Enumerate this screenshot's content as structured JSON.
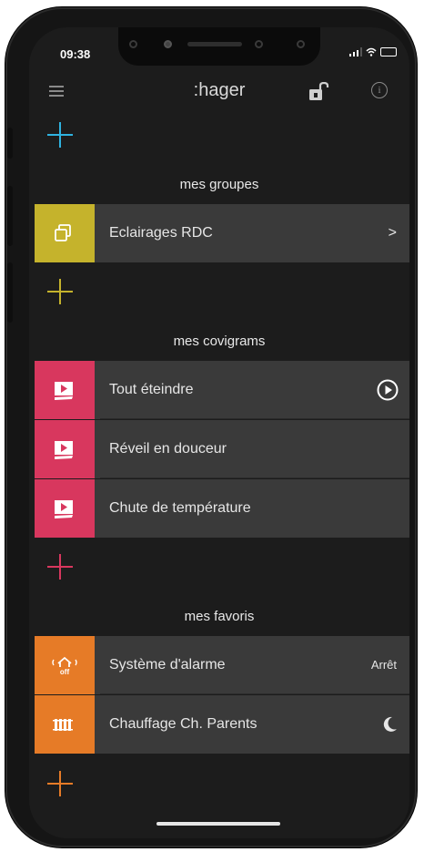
{
  "status": {
    "time": "09:38"
  },
  "app": {
    "logo": ":hager",
    "info_icon": "i"
  },
  "colors": {
    "accent_blue": "#2fb3e0",
    "group_tile": "#c5b32c",
    "covigram_tile": "#d8375e",
    "favori_tile": "#e67b27"
  },
  "sections": {
    "groupes": {
      "title": "mes groupes"
    },
    "covigrams": {
      "title": "mes covigrams"
    },
    "favoris": {
      "title": "mes favoris"
    }
  },
  "groupes": [
    {
      "label": "Eclairages RDC",
      "icon": "group-icon",
      "trail": ">"
    }
  ],
  "covigrams": [
    {
      "label": "Tout éteindre",
      "icon": "scenario-icon"
    },
    {
      "label": "Réveil en douceur",
      "icon": "scenario-icon"
    },
    {
      "label": "Chute de température",
      "icon": "scenario-icon"
    }
  ],
  "favoris": [
    {
      "label": "Système d'alarme",
      "icon": "alarm-icon",
      "trail": "Arrêt",
      "icon_text": "off"
    },
    {
      "label": "Chauffage Ch. Parents",
      "icon": "radiator-icon"
    }
  ]
}
